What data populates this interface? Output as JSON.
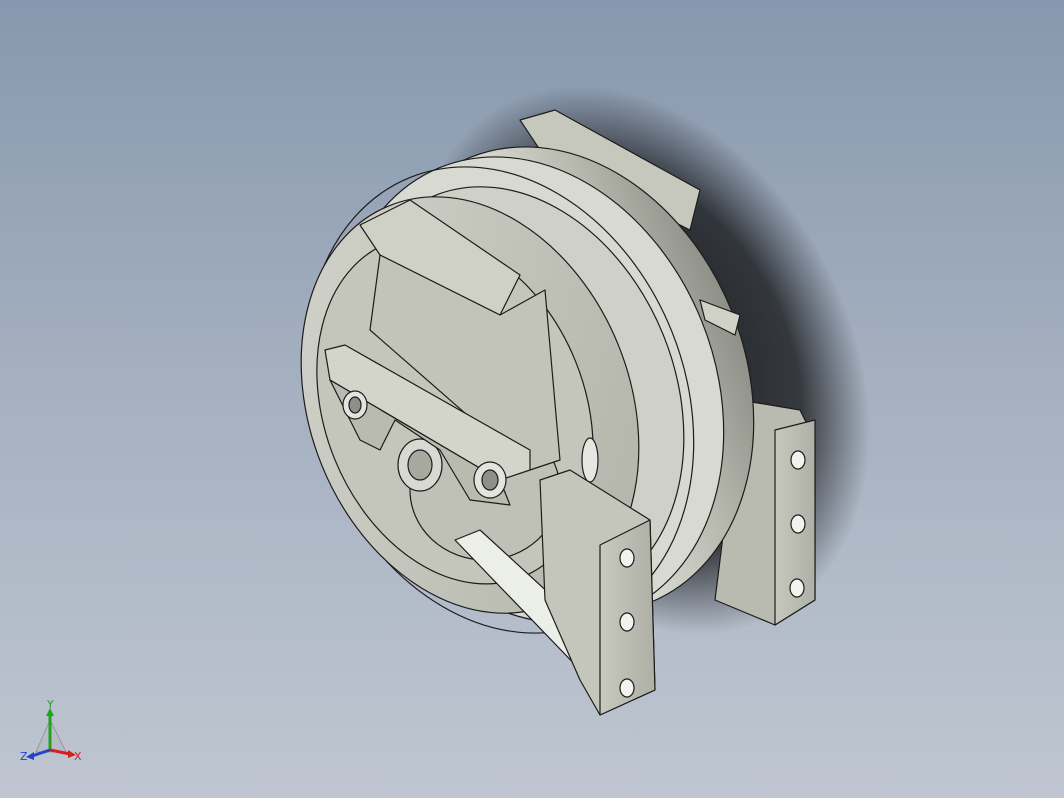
{
  "viewport": {
    "background_top": "#8797ad",
    "background_bottom": "#bfc6d1",
    "model_color": "#c9cbc0",
    "edge_color": "#1c1c1c"
  },
  "triad": {
    "x_label": "X",
    "y_label": "Y",
    "z_label": "Z",
    "x_color": "#d42020",
    "y_color": "#1fa31f",
    "z_color": "#2244cc"
  }
}
